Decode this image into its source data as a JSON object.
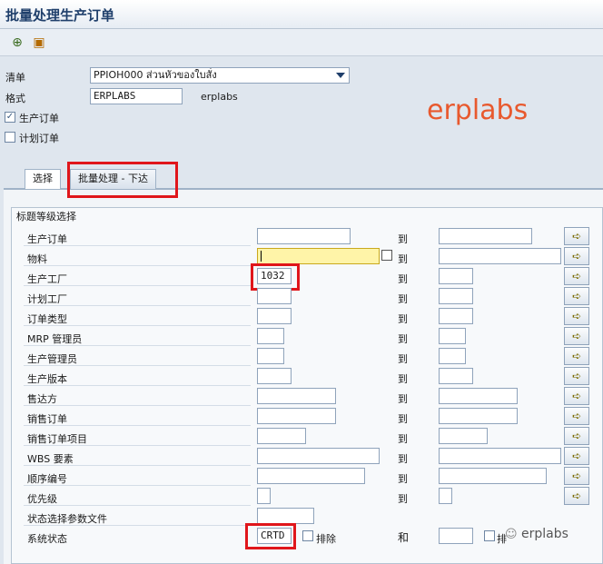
{
  "window": {
    "title": "批量处理生产订单"
  },
  "toolbar": {
    "execute_icon": "execute-icon",
    "variant_icon": "variant-icon"
  },
  "header": {
    "list_label": "清单",
    "list_value": "PPIOH000 ส่วนหัวของใบสั่ง",
    "format_label": "格式",
    "format_value": "ERPLABS",
    "format_desc": "erplabs",
    "production_order_label": "生产订单",
    "production_order_checked": true,
    "planned_order_label": "计划订单",
    "planned_order_checked": false
  },
  "watermark": "erplabs",
  "tabs": [
    {
      "label": "选择"
    },
    {
      "label": "批量处理 - 下达"
    }
  ],
  "group": {
    "title": "标题等级选择",
    "to_label": "到",
    "and_label": "和",
    "exclude_label": "排除",
    "rows": [
      {
        "label": "生产订单",
        "value": ""
      },
      {
        "label": "物料",
        "value": ""
      },
      {
        "label": "生产工厂",
        "value": "1032"
      },
      {
        "label": "计划工厂",
        "value": ""
      },
      {
        "label": "订单类型",
        "value": ""
      },
      {
        "label": "MRP 管理员",
        "value": ""
      },
      {
        "label": "生产管理员",
        "value": ""
      },
      {
        "label": "生产版本",
        "value": ""
      },
      {
        "label": "售达方",
        "value": ""
      },
      {
        "label": "销售订单",
        "value": ""
      },
      {
        "label": "销售订单项目",
        "value": ""
      },
      {
        "label": "WBS 要素",
        "value": ""
      },
      {
        "label": "顺序编号",
        "value": ""
      },
      {
        "label": "优先级",
        "value": ""
      },
      {
        "label": "状态选择参数文件",
        "value": ""
      },
      {
        "label": "系统状态",
        "value": "CRTD"
      }
    ],
    "status_exclude_label_right": "排"
  },
  "footer_watermark": "erplabs"
}
